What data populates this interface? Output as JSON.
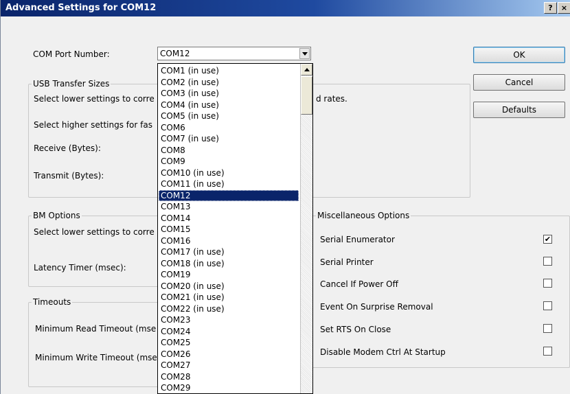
{
  "window": {
    "title": "Advanced Settings for COM12",
    "help_button": "?",
    "close_button": "×"
  },
  "com_port": {
    "label": "COM Port Number:",
    "value": "COM12",
    "options": [
      "COM1 (in use)",
      "COM2 (in use)",
      "COM3 (in use)",
      "COM4 (in use)",
      "COM5 (in use)",
      "COM6",
      "COM7 (in use)",
      "COM8",
      "COM9",
      "COM10 (in use)",
      "COM11 (in use)",
      "COM12",
      "COM13",
      "COM14",
      "COM15",
      "COM16",
      "COM17 (in use)",
      "COM18 (in use)",
      "COM19",
      "COM20 (in use)",
      "COM21 (in use)",
      "COM22 (in use)",
      "COM23",
      "COM24",
      "COM25",
      "COM26",
      "COM27",
      "COM28",
      "COM29"
    ],
    "selected_index": 11
  },
  "usb_transfer": {
    "legend": "USB Transfer Sizes",
    "line1_start": "Select lower settings to corre",
    "line1_end": "d rates.",
    "line2": "Select higher settings for fas",
    "receive_label": "Receive (Bytes):",
    "transmit_label": "Transmit (Bytes):"
  },
  "bm_options": {
    "legend": "BM Options",
    "line1": "Select lower settings to corre",
    "latency_label": "Latency Timer (msec):"
  },
  "timeouts": {
    "legend": "Timeouts",
    "min_read": "Minimum Read Timeout (mse",
    "min_write": "Minimum Write Timeout (mse"
  },
  "misc": {
    "legend": "Miscellaneous Options",
    "items": [
      {
        "label": "Serial Enumerator",
        "checked": true,
        "mark": "✔"
      },
      {
        "label": "Serial Printer",
        "checked": false,
        "mark": ""
      },
      {
        "label": "Cancel If Power Off",
        "checked": false,
        "mark": ""
      },
      {
        "label": "Event On Surprise Removal",
        "checked": false,
        "mark": ""
      },
      {
        "label": "Set RTS On Close",
        "checked": false,
        "mark": ""
      },
      {
        "label": "Disable Modem Ctrl At Startup",
        "checked": false,
        "mark": ""
      }
    ]
  },
  "buttons": {
    "ok": "OK",
    "cancel": "Cancel",
    "defaults": "Defaults"
  }
}
